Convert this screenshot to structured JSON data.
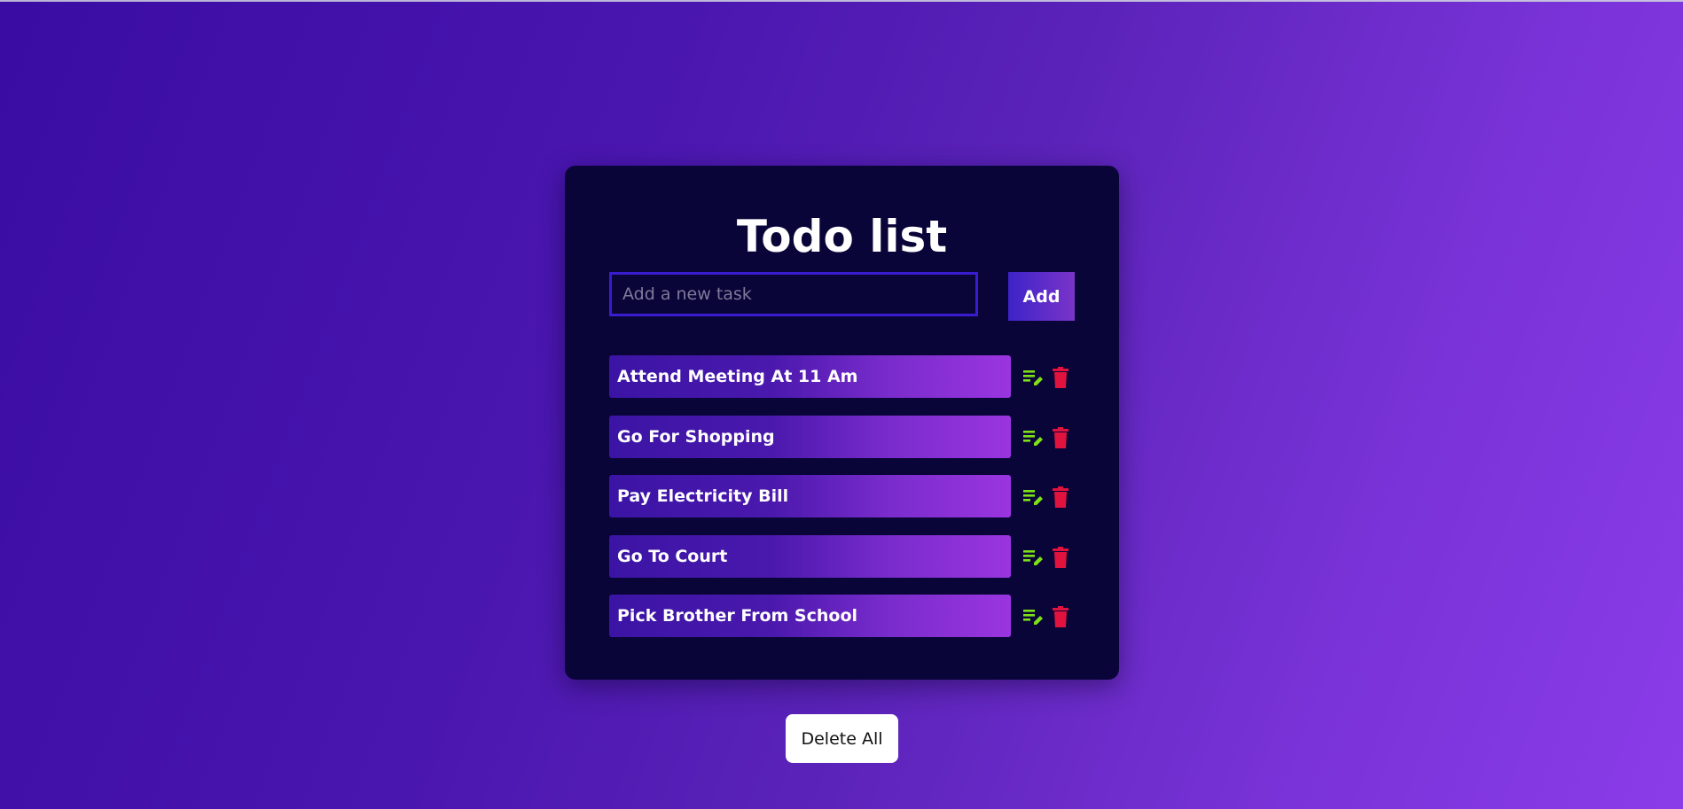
{
  "app": {
    "title": "Todo list"
  },
  "input": {
    "placeholder": "Add a new task",
    "value": ""
  },
  "add_button": {
    "label": "Add"
  },
  "tasks": [
    {
      "label": "Attend Meeting At 11 Am"
    },
    {
      "label": "Go For Shopping"
    },
    {
      "label": "Pay Electricity Bill"
    },
    {
      "label": "Go To Court"
    },
    {
      "label": "Pick Brother From School"
    }
  ],
  "icons": {
    "edit": "edit-list-icon",
    "delete": "trash-icon"
  },
  "colors": {
    "edit_icon": "#7fe017",
    "delete_icon": "#e0123e",
    "card_bg": "#0a0538",
    "input_border": "#3a1ccf"
  },
  "delete_all_button": {
    "label": "Delete All"
  }
}
